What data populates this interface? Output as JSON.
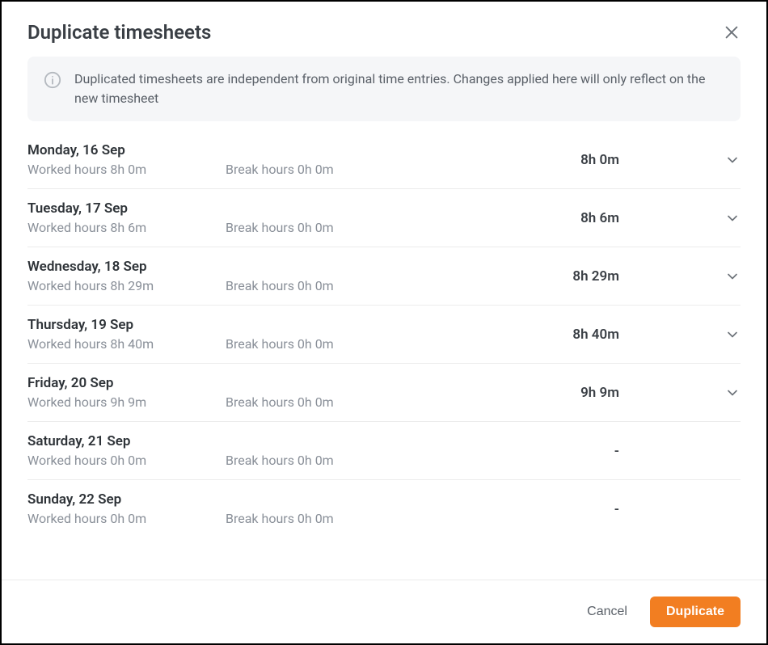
{
  "modal": {
    "title": "Duplicate timesheets",
    "info": "Duplicated timesheets are independent from original time entries. Changes applied here will only reflect on the new timesheet"
  },
  "days": [
    {
      "date": "Monday, 16 Sep",
      "worked": "Worked hours 8h 0m",
      "break": "Break hours 0h 0m",
      "total": "8h 0m",
      "expandable": true
    },
    {
      "date": "Tuesday, 17 Sep",
      "worked": "Worked hours 8h 6m",
      "break": "Break hours 0h 0m",
      "total": "8h 6m",
      "expandable": true
    },
    {
      "date": "Wednesday, 18 Sep",
      "worked": "Worked hours 8h 29m",
      "break": "Break hours 0h 0m",
      "total": "8h 29m",
      "expandable": true
    },
    {
      "date": "Thursday, 19 Sep",
      "worked": "Worked hours 8h 40m",
      "break": "Break hours 0h 0m",
      "total": "8h 40m",
      "expandable": true
    },
    {
      "date": "Friday, 20 Sep",
      "worked": "Worked hours 9h 9m",
      "break": "Break hours 0h 0m",
      "total": "9h 9m",
      "expandable": true
    },
    {
      "date": "Saturday, 21 Sep",
      "worked": "Worked hours 0h 0m",
      "break": "Break hours 0h 0m",
      "total": "-",
      "expandable": false
    },
    {
      "date": "Sunday, 22 Sep",
      "worked": "Worked hours 0h 0m",
      "break": "Break hours 0h 0m",
      "total": "-",
      "expandable": false
    }
  ],
  "footer": {
    "cancel": "Cancel",
    "duplicate": "Duplicate"
  }
}
